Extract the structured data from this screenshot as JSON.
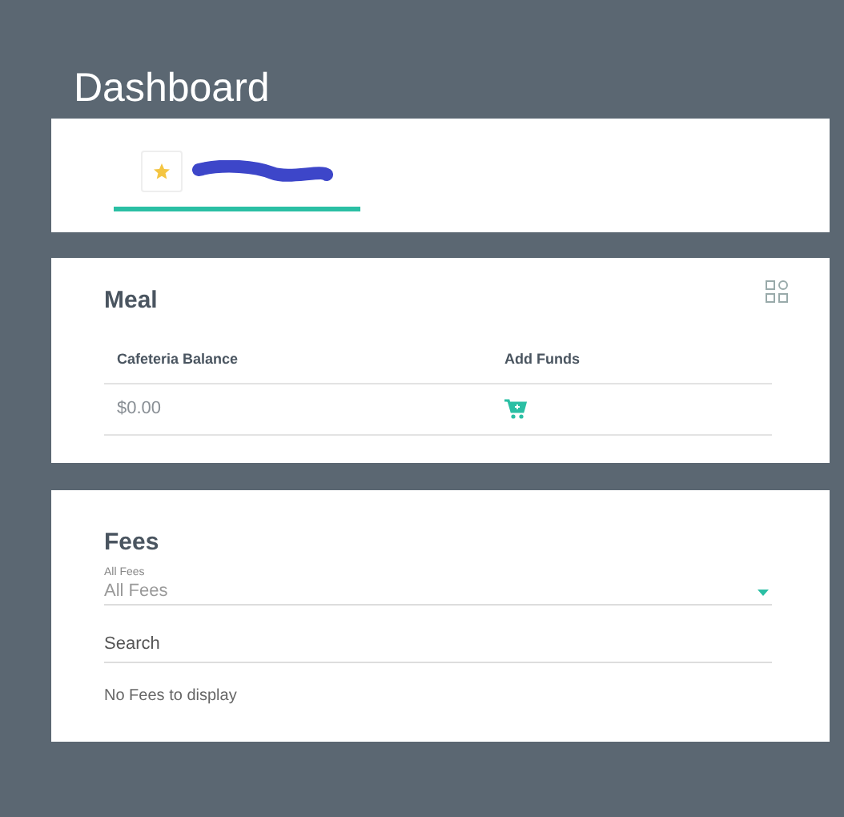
{
  "page": {
    "title": "Dashboard"
  },
  "student_tabs": [
    {
      "selected": true
    }
  ],
  "meal": {
    "title": "Meal",
    "columns": [
      "Cafeteria Balance",
      "Add Funds"
    ],
    "balance": "$0.00"
  },
  "fees": {
    "title": "Fees",
    "filter": {
      "label": "All Fees",
      "value": "All Fees"
    },
    "search": {
      "placeholder": "Search"
    },
    "empty_message": "No Fees to display"
  }
}
